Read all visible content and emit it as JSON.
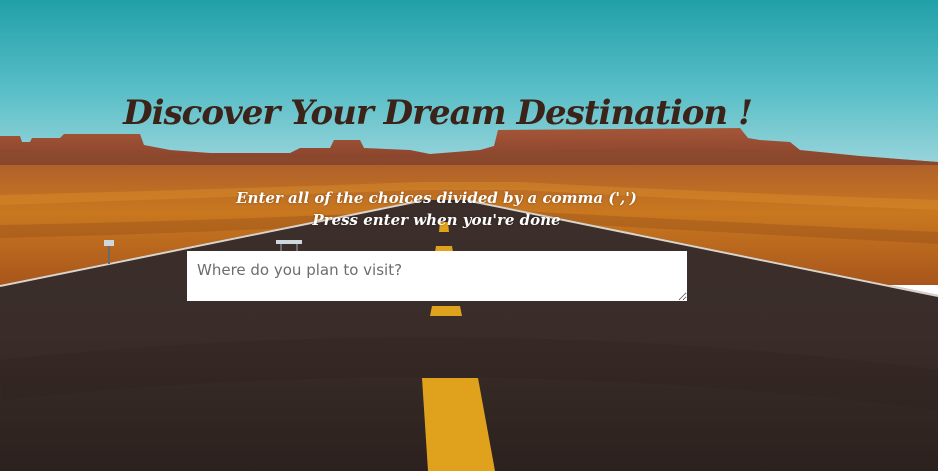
{
  "header": {
    "title": "Discover Your Dream Destination !"
  },
  "instructions": {
    "line1": "Enter all of the choices divided by a comma (',')",
    "line2": "Press enter when you're done"
  },
  "search": {
    "placeholder": "Where do you plan to visit?",
    "value": ""
  },
  "colors": {
    "title_color": "#3b231a",
    "instruction_color": "#ffffff",
    "sky_color": "#2a9ea6",
    "road_color": "#3a2f2c",
    "road_marking_color": "#e0a21c"
  },
  "icons": {
    "background_scene": "desert-road-image"
  }
}
